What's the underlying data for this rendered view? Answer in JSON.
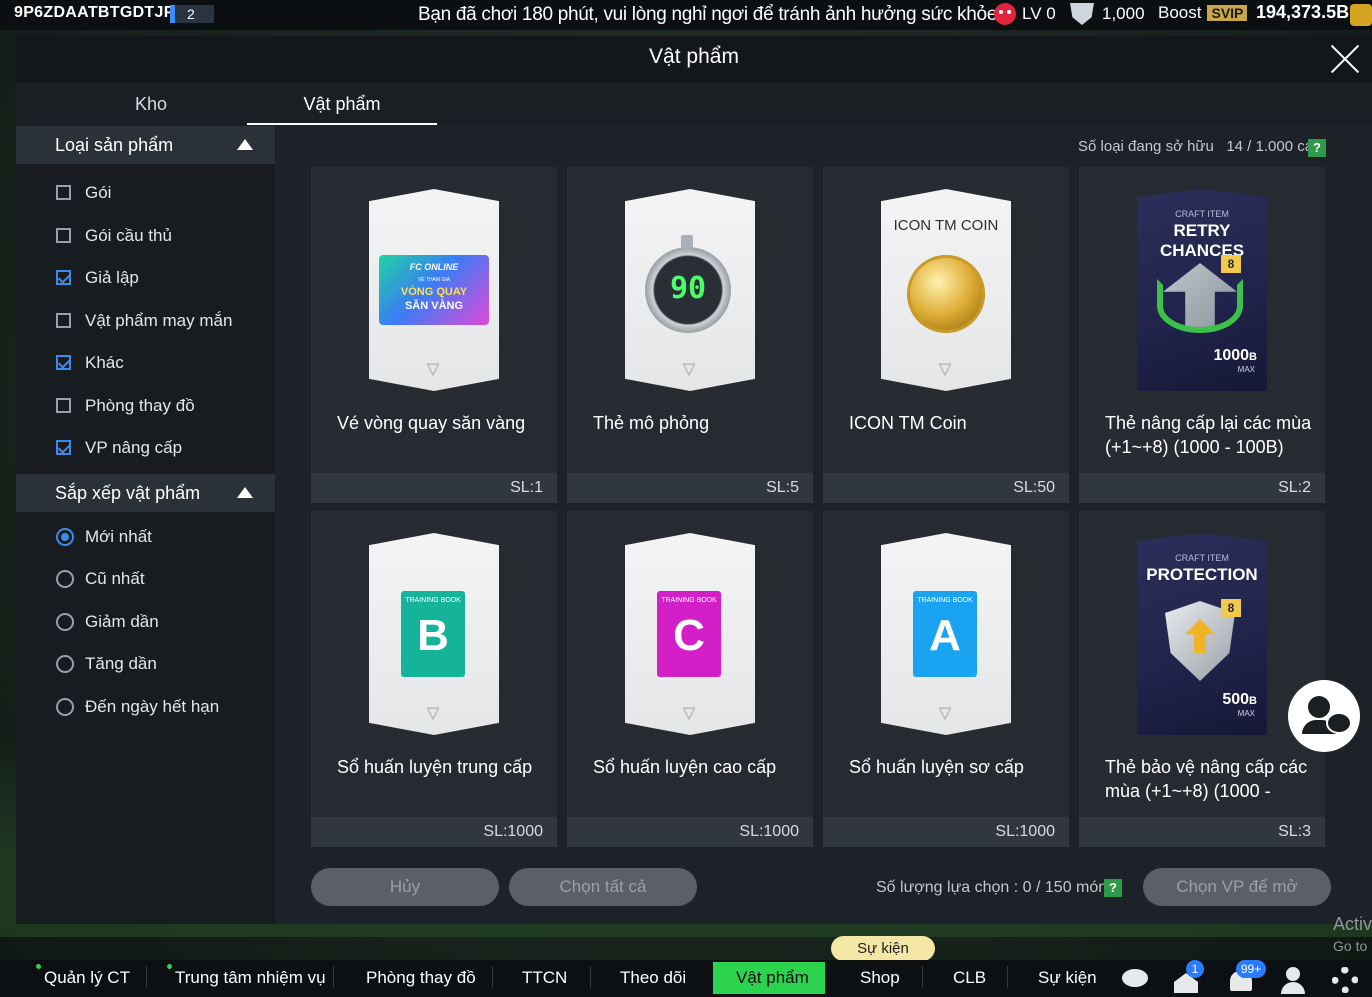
{
  "topbar": {
    "user_id": "9P6ZDAATBTGDTJP",
    "user_badge": "2",
    "warning": "Bạn đã chơi 180 phút, vui lòng nghỉ ngơi để tránh ảnh hưởng sức khỏe",
    "level": "LV 0",
    "points": "1,000",
    "boost_label": "Boost",
    "svip": "SVIP",
    "money": "194,373.5B"
  },
  "modal": {
    "title": "Vật phẩm",
    "tabs": [
      "Kho",
      "Vật phẩm"
    ],
    "active_tab": "Vật phẩm"
  },
  "sidebar": {
    "type_header": "Loại sản phẩm",
    "type_options": [
      {
        "label": "Gói",
        "checked": false
      },
      {
        "label": "Gói cầu thủ",
        "checked": false
      },
      {
        "label": "Giả lập",
        "checked": true
      },
      {
        "label": "Vật phẩm may mắn",
        "checked": false
      },
      {
        "label": "Khác",
        "checked": true
      },
      {
        "label": "Phòng thay đồ",
        "checked": false
      },
      {
        "label": "VP nâng cấp",
        "checked": true
      }
    ],
    "sort_header": "Sắp xếp vật phẩm",
    "sort_options": [
      {
        "label": "Mới nhất",
        "selected": true
      },
      {
        "label": "Cũ nhất",
        "selected": false
      },
      {
        "label": "Giảm dần",
        "selected": false
      },
      {
        "label": "Tăng dần",
        "selected": false
      },
      {
        "label": "Đến ngày hết hạn",
        "selected": false
      }
    ]
  },
  "owned": {
    "label": "Số loại đang sở hữu",
    "value": "14 / 1.000 cái",
    "help": "?"
  },
  "items": [
    {
      "name": "Vé vòng quay săn vàng",
      "sl": "SL:1",
      "art": "ticket",
      "ticket_brand": "FC ONLINE",
      "ticket_sub": "VÉ THAM GIA",
      "ticket_title": "VÒNG QUAY",
      "ticket_title2": "SĂN VÀNG"
    },
    {
      "name": "Thẻ mô phỏng",
      "sl": "SL:5",
      "art": "stopwatch",
      "art_value": "90"
    },
    {
      "name": "ICON TM Coin",
      "sl": "SL:50",
      "art": "coin",
      "art_title": "ICON TM COIN"
    },
    {
      "name": "Thẻ nâng cấp lại các mùa (+1~+8) (1000 - 100B)",
      "sl": "SL:2",
      "art": "craft",
      "craft_kicker": "CRAFT ITEM",
      "craft_title": "RETRY CHANCES",
      "craft_level": "8",
      "craft_amount": "1000",
      "craft_unit": "B",
      "craft_max": "MAX"
    },
    {
      "name": "Sổ huấn luyện trung cấp",
      "sl": "SL:1000",
      "art": "book",
      "book_letter": "B",
      "book_label": "TRAINING BOOK",
      "book_color": "#14b39a"
    },
    {
      "name": "Sổ huấn luyện cao cấp",
      "sl": "SL:1000",
      "art": "book",
      "book_letter": "C",
      "book_label": "TRAINING BOOK",
      "book_color": "#d21fc8"
    },
    {
      "name": "Sổ huấn luyện sơ cấp",
      "sl": "SL:1000",
      "art": "book",
      "book_letter": "A",
      "book_label": "TRAINING BOOK",
      "book_color": "#1aa3f0"
    },
    {
      "name": "Thẻ bảo vệ nâng cấp các mùa (+1~+8) (1000 -",
      "sl": "SL:3",
      "art": "craft",
      "craft_kicker": "CRAFT ITEM",
      "craft_title": "PROTECTION",
      "craft_level": "8",
      "craft_amount": "500",
      "craft_unit": "B",
      "craft_max": "MAX"
    }
  ],
  "actions": {
    "cancel": "Hủy",
    "select_all": "Chọn tất cả",
    "selection_info": "Số lượng lựa chọn : 0 / 150 món",
    "help": "?",
    "open": "Chọn VP để mở"
  },
  "watermark": {
    "line1": "Activ",
    "line2": "Go to"
  },
  "bottomnav": {
    "items": [
      "Quản lý CT",
      "Trung tâm nhiệm vụ",
      "Phòng thay đồ",
      "TTCN",
      "Theo dõi",
      "Vật phẩm",
      "Shop",
      "CLB",
      "Sự kiện"
    ],
    "active": "Vật phẩm",
    "event_pill": "Sự kiện",
    "home_badge": "1",
    "notif_badge": "99+"
  },
  "colors": {
    "accent": "#2cd44d",
    "check": "#3c8ce7",
    "help": "#2e9a4a"
  }
}
